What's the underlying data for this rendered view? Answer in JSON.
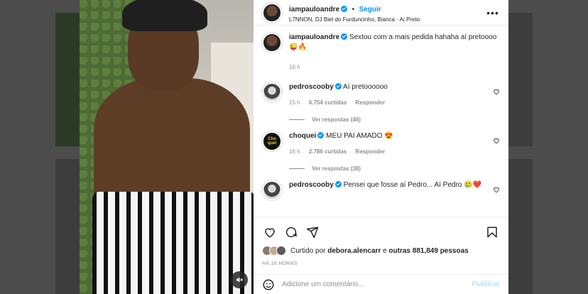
{
  "post": {
    "username": "iampaulo​andre",
    "follow_label": "Seguir",
    "audio_line": "L7NNON, DJ Biel do Furduncinho, Bianca · Ai Preto",
    "caption": "Sextou com a mais pedida hahaha aí pretoooo 😜🔥",
    "caption_time": "16 h"
  },
  "comments": [
    {
      "username": "pedroscooby",
      "text": "Aí pretoooooo",
      "time": "15 h",
      "likes": "6.754 curtidas",
      "reply": "Responder",
      "view_replies": "Ver respostas (46)"
    },
    {
      "username": "choquei",
      "text": "MEU PAI AMADO 😍",
      "time": "16 h",
      "likes": "2.786 curtidas",
      "reply": "Responder",
      "view_replies": "Ver respostas (38)"
    },
    {
      "username": "pedroscooby",
      "text": "Pensei que fosse aí Pedro... Aí Pedro 🥲❤️",
      "time": "",
      "likes": "",
      "reply": "",
      "view_replies": ""
    }
  ],
  "likes_line": {
    "prefix": "Curtido por",
    "user": "debora.alencarr",
    "middle": "e",
    "others": "outras 881,849 pessoas"
  },
  "posted_ago": "HÁ 16 HORAS",
  "add_comment": {
    "placeholder": "Adicione um comentário...",
    "publish_label": "Publicar"
  },
  "avatar_labels": {
    "choquei": "Cho quei"
  },
  "icons": [
    "more-options-icon",
    "verified-badge-icon",
    "heart-icon",
    "comment-icon",
    "share-icon",
    "bookmark-icon",
    "emoji-icon",
    "mute-icon"
  ],
  "colors": {
    "accent": "#0095f6",
    "secondary_text": "#8e8e8e",
    "publish_disabled": "#b2dffc"
  }
}
